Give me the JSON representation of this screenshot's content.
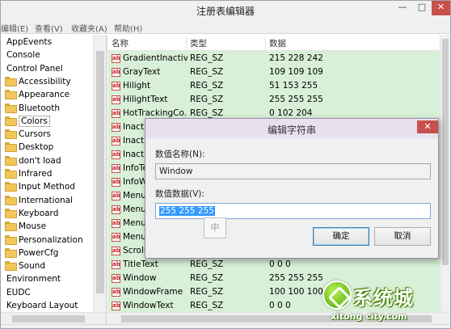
{
  "window": {
    "title": "注册表编辑器",
    "min_glyph": "—",
    "max_glyph": "□",
    "close_glyph": "✕"
  },
  "menu": [
    "编辑(E)",
    "查看(V)",
    "收藏夹(A)",
    "帮助(H)"
  ],
  "tree": {
    "roots_above": [
      "AppEvents",
      "Console",
      "Control Panel"
    ],
    "children": [
      "Accessibility",
      "Appearance",
      "Bluetooth",
      "Colors",
      "Cursors",
      "Desktop",
      "don't load",
      "Infrared",
      "Input Method",
      "International",
      "Keyboard",
      "Mouse",
      "Personalization",
      "PowerCfg",
      "Sound"
    ],
    "selected": "Colors",
    "roots_below": [
      "Environment",
      "EUDC",
      "Keyboard Layout"
    ]
  },
  "list": {
    "columns": {
      "name": "名称",
      "type": "类型",
      "data": "数据"
    },
    "value_icon": "ab",
    "rows": [
      {
        "name": "GradientInactiv...",
        "type": "REG_SZ",
        "data": "215 228 242"
      },
      {
        "name": "GrayText",
        "type": "REG_SZ",
        "data": "109 109 109"
      },
      {
        "name": "Hilight",
        "type": "REG_SZ",
        "data": "51 153 255"
      },
      {
        "name": "HilightText",
        "type": "REG_SZ",
        "data": "255 255 255"
      },
      {
        "name": "HotTrackingCo...",
        "type": "REG_SZ",
        "data": "0 102 204"
      },
      {
        "name": "Inacti",
        "type": "",
        "data": ""
      },
      {
        "name": "Inacti",
        "type": "",
        "data": ""
      },
      {
        "name": "Inacti",
        "type": "",
        "data": ""
      },
      {
        "name": "InfoTe",
        "type": "",
        "data": ""
      },
      {
        "name": "InfoWi",
        "type": "",
        "data": ""
      },
      {
        "name": "Menu",
        "type": "",
        "data": ""
      },
      {
        "name": "Menu",
        "type": "",
        "data": ""
      },
      {
        "name": "Menu",
        "type": "",
        "data": ""
      },
      {
        "name": "Menu",
        "type": "",
        "data": ""
      },
      {
        "name": "Scroll",
        "type": "",
        "data": ""
      },
      {
        "name": "TitleText",
        "type": "REG_SZ",
        "data": "0 0 0"
      },
      {
        "name": "Window",
        "type": "REG_SZ",
        "data": "255 255 255"
      },
      {
        "name": "WindowFrame",
        "type": "REG_SZ",
        "data": "100 100 100"
      },
      {
        "name": "WindowText",
        "type": "REG_SZ",
        "data": "0 0 0"
      }
    ]
  },
  "dialog": {
    "title": "编辑字符串",
    "close_glyph": "✕",
    "name_label": "数值名称(N):",
    "name_value": "Window",
    "data_label": "数值数据(V):",
    "data_value": "255 255 255",
    "ime_indicator": "中",
    "ok_label": "确定",
    "cancel_label": "取消"
  },
  "watermark": {
    "brand": "系统城",
    "url": "xitong city.com"
  },
  "colors": {
    "list_background": "#d8f0d8",
    "selection_blue": "#3399ff",
    "close_button_red": "#c7504c"
  }
}
